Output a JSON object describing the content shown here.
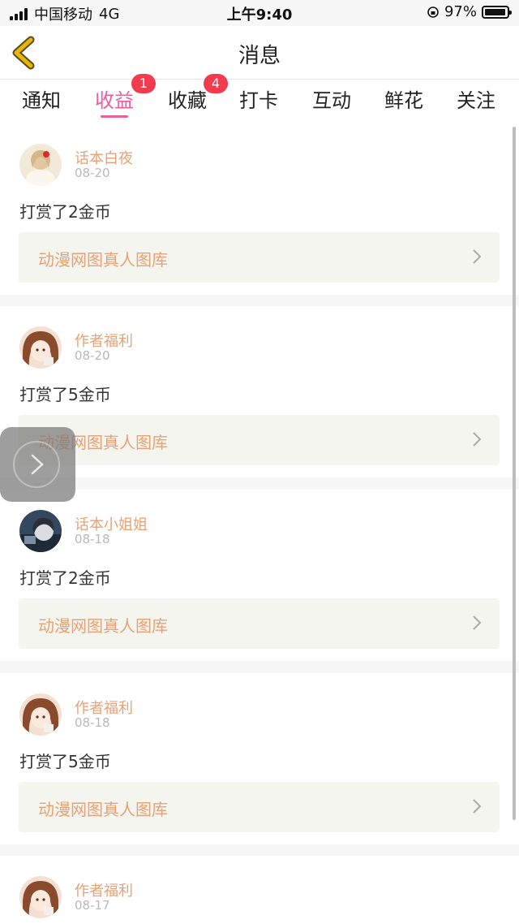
{
  "status_bar": {
    "carrier": "中国移动",
    "network": "4G",
    "time": "上午9:40",
    "battery": "97%",
    "battery_level": 0.97
  },
  "header": {
    "title": "消息",
    "back_icon": "chevron-left-icon"
  },
  "tabs": [
    {
      "label": "通知",
      "badge": ""
    },
    {
      "label": "收益",
      "badge": "1",
      "active": true
    },
    {
      "label": "收藏",
      "badge": "4"
    },
    {
      "label": "打卡",
      "badge": ""
    },
    {
      "label": "互动",
      "badge": ""
    },
    {
      "label": "鲜花",
      "badge": ""
    },
    {
      "label": "关注",
      "badge": ""
    }
  ],
  "messages": [
    {
      "author": "话本白夜",
      "date": "08-20",
      "text": "打赏了2金币",
      "work": "动漫网图真人图库"
    },
    {
      "author": "作者福利",
      "date": "08-20",
      "text": "打赏了5金币",
      "work": "动漫网图真人图库"
    },
    {
      "author": "话本小姐姐",
      "date": "08-18",
      "text": "打赏了2金币",
      "work": "动漫网图真人图库"
    },
    {
      "author": "作者福利",
      "date": "08-18",
      "text": "打赏了5金币",
      "work": "动漫网图真人图库"
    },
    {
      "author": "作者福利",
      "date": "08-17",
      "text": "",
      "work": ""
    }
  ],
  "colors": {
    "accent": "#e85f9b",
    "author": "#e8a174",
    "badge": "#f23c4e",
    "back_arrow": "#e6b800"
  }
}
